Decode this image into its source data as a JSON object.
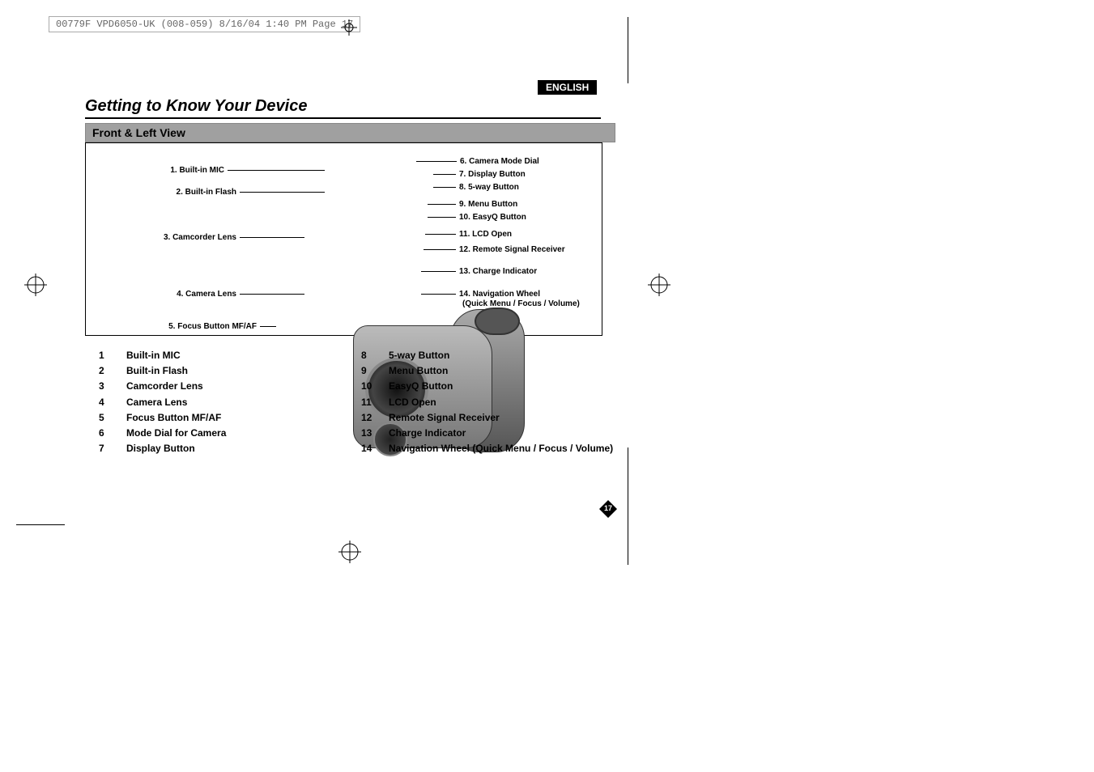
{
  "file_header": "00779F VPD6050-UK (008-059)  8/16/04 1:40 PM  Page 17",
  "language_badge": "ENGLISH",
  "title": "Getting to Know Your Device",
  "section_title": "Front & Left View",
  "diagram_labels_left": [
    "1. Built-in MIC",
    "2. Built-in Flash",
    "3. Camcorder Lens",
    "4. Camera Lens",
    "5. Focus Button MF/AF"
  ],
  "diagram_labels_right": [
    "6. Camera Mode Dial",
    "7. Display Button",
    "8. 5-way Button",
    "9. Menu Button",
    "10. EasyQ Button",
    "11. LCD Open",
    "12. Remote Signal Receiver",
    "13. Charge Indicator",
    "14. Navigation Wheel",
    "      (Quick Menu / Focus / Volume)"
  ],
  "legend_left": [
    {
      "n": "1",
      "t": "Built-in MIC"
    },
    {
      "n": "2",
      "t": "Built-in Flash"
    },
    {
      "n": "3",
      "t": "Camcorder Lens"
    },
    {
      "n": "4",
      "t": "Camera Lens"
    },
    {
      "n": "5",
      "t": "Focus Button MF/AF"
    },
    {
      "n": "6",
      "t": "Mode Dial for Camera"
    },
    {
      "n": "7",
      "t": "Display Button"
    }
  ],
  "legend_right": [
    {
      "n": "8",
      "t": "5-way Button"
    },
    {
      "n": "9",
      "t": "Menu Button"
    },
    {
      "n": "10",
      "t": "EasyQ Button"
    },
    {
      "n": "11",
      "t": "LCD Open"
    },
    {
      "n": "12",
      "t": "Remote Signal Receiver"
    },
    {
      "n": "13",
      "t": "Charge Indicator"
    },
    {
      "n": "14",
      "t": "Navigation Wheel (Quick Menu / Focus / Volume)"
    }
  ],
  "page_number": "17"
}
